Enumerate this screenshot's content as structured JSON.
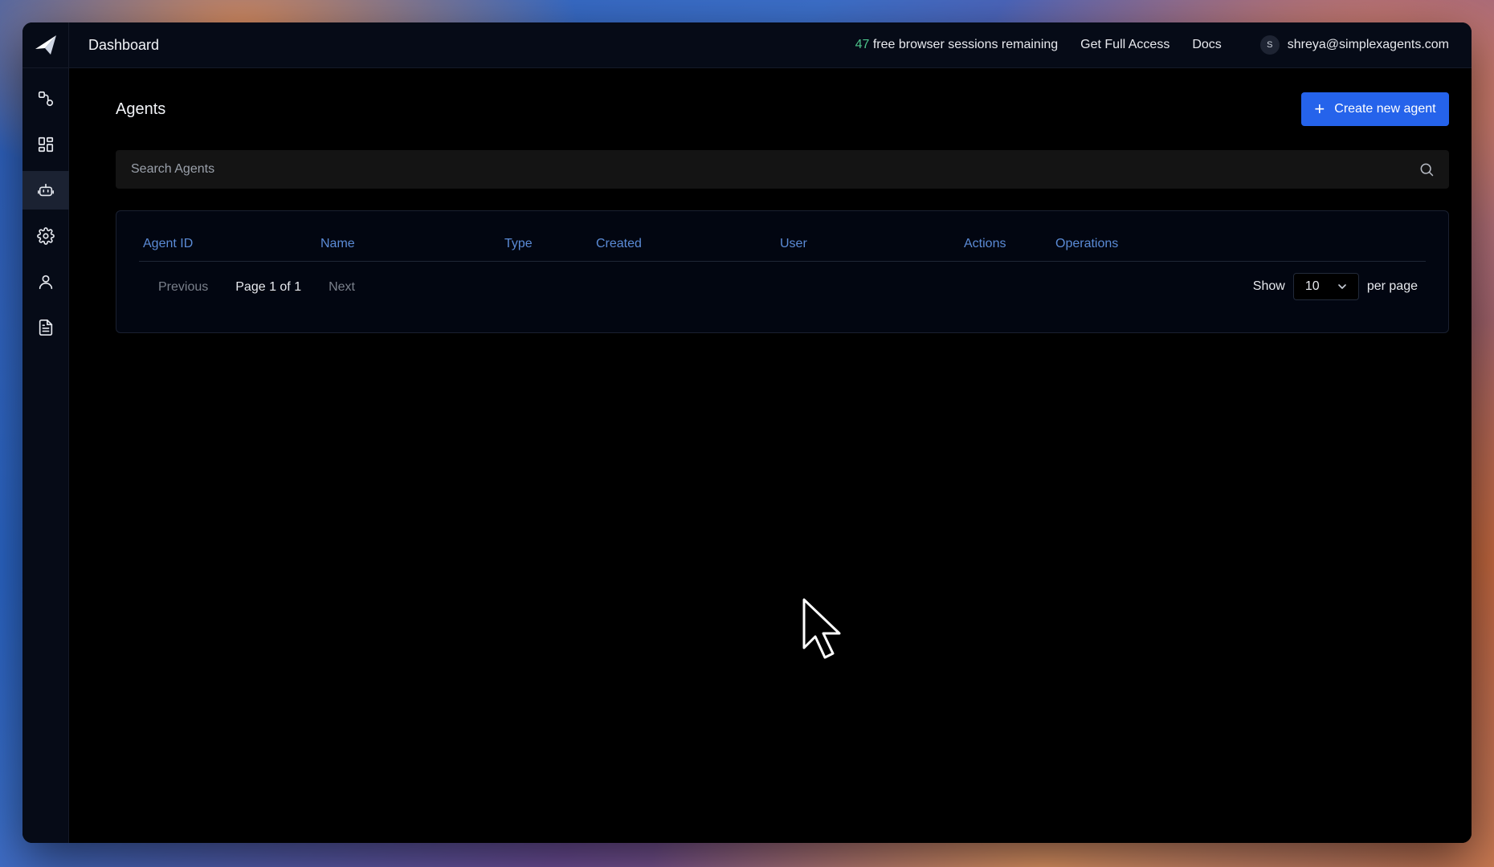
{
  "header": {
    "title": "Dashboard",
    "sessions_count": "47",
    "sessions_text": "free browser sessions remaining",
    "get_full_access": "Get Full Access",
    "docs": "Docs",
    "avatar_initial": "S",
    "user_email": "shreya@simplexagents.com"
  },
  "sidebar": {
    "items": [
      {
        "name": "workflow-icon",
        "active": false
      },
      {
        "name": "dashboard-grid-icon",
        "active": false
      },
      {
        "name": "robot-agent-icon",
        "active": true
      },
      {
        "name": "gear-icon",
        "active": false
      },
      {
        "name": "user-icon",
        "active": false
      },
      {
        "name": "document-icon",
        "active": false
      }
    ]
  },
  "main": {
    "title": "Agents",
    "create_button": "Create new agent",
    "search_placeholder": "Search Agents",
    "table": {
      "columns": [
        "Agent ID",
        "Name",
        "Type",
        "Created",
        "User",
        "Actions",
        "Operations"
      ],
      "rows": []
    },
    "pagination": {
      "previous": "Previous",
      "page_info": "Page 1 of 1",
      "next": "Next",
      "show_label": "Show",
      "per_page_value": "10",
      "per_page_label": "per page"
    }
  },
  "colors": {
    "accent": "#2563eb",
    "header_link": "#5b8bd6",
    "sessions_count": "#4cc38a"
  }
}
